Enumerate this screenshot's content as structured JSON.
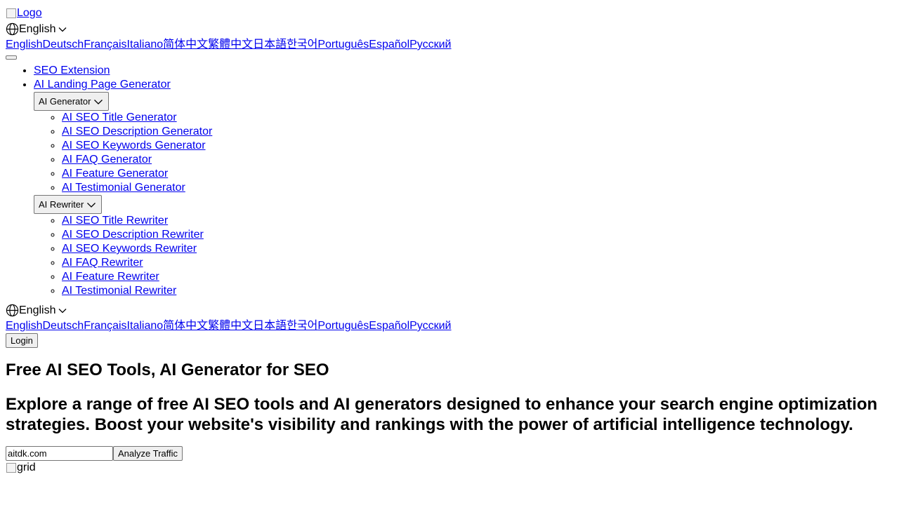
{
  "header": {
    "logo_alt": "Logo",
    "language_current": "English",
    "languages": [
      "English",
      "Deutsch",
      "Français",
      "Italiano",
      "简体中文",
      "繁體中文",
      "日本語",
      "한국어",
      "Português",
      "Español",
      "Русский"
    ]
  },
  "nav": {
    "items": [
      "SEO Extension",
      "AI Landing Page Generator"
    ],
    "generator": {
      "label": "AI Generator",
      "items": [
        "AI SEO Title Generator",
        "AI SEO Description Generator",
        "AI SEO Keywords Generator",
        "AI FAQ Generator",
        "AI Feature Generator",
        "AI Testimonial Generator"
      ]
    },
    "rewriter": {
      "label": "AI Rewriter",
      "items": [
        "AI SEO Title Rewriter",
        "AI SEO Description Rewriter",
        "AI SEO Keywords Rewriter",
        "AI FAQ Rewriter",
        "AI Feature Rewriter",
        "AI Testimonial Rewriter"
      ]
    },
    "login_label": "Login"
  },
  "hero": {
    "title": "Free AI SEO Tools, AI Generator for SEO",
    "subtitle": "Explore a range of free AI SEO tools and AI generators designed to enhance your search engine optimization strategies. Boost your website's visibility and rankings with the power of artificial intelligence technology.",
    "domain_input_value": "aitdk.com",
    "analyze_label": "Analyze Traffic",
    "grid_alt": "grid"
  },
  "icons": {
    "globe": "globe-icon",
    "chevron": "chevron-down-icon",
    "broken_image": "broken-image-icon"
  }
}
